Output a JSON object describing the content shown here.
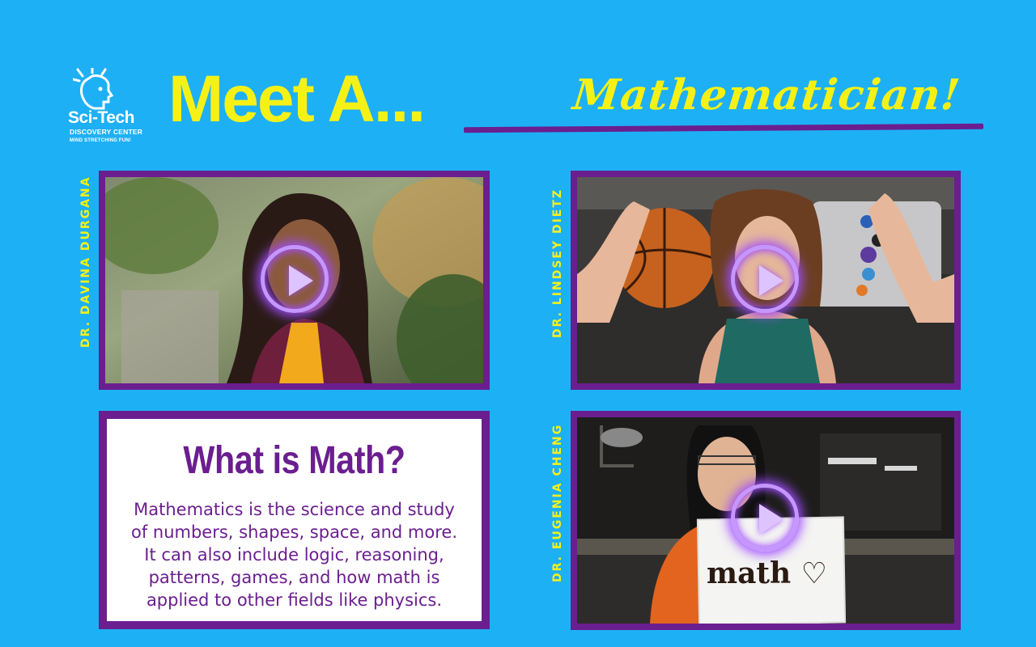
{
  "logo": {
    "name": "Sci-Tech",
    "subtitle": "DISCOVERY CENTER",
    "tagline": "MIND STRETCHING FUN!"
  },
  "header": {
    "title": "Meet A...",
    "subtitle": "Mathematician!"
  },
  "videos": [
    {
      "name": "DR. DAVINA DURGANA",
      "icon": "play-icon"
    },
    {
      "name": "DR. LINDSEY DIETZ",
      "icon": "play-icon"
    },
    {
      "name": "DR. EUGENIA CHENG",
      "icon": "play-icon",
      "sign_text": "math ♡"
    }
  ],
  "info": {
    "title": "What is Math?",
    "body": "Mathematics is the science and study of numbers, shapes, space, and more. It can also include logic, reasoning, patterns, games, and how math is applied to other fields like physics."
  },
  "colors": {
    "background": "#1eb0f5",
    "accent_yellow": "#f5f116",
    "frame_purple": "#6b1e8f",
    "play_glow": "#a04dff"
  }
}
